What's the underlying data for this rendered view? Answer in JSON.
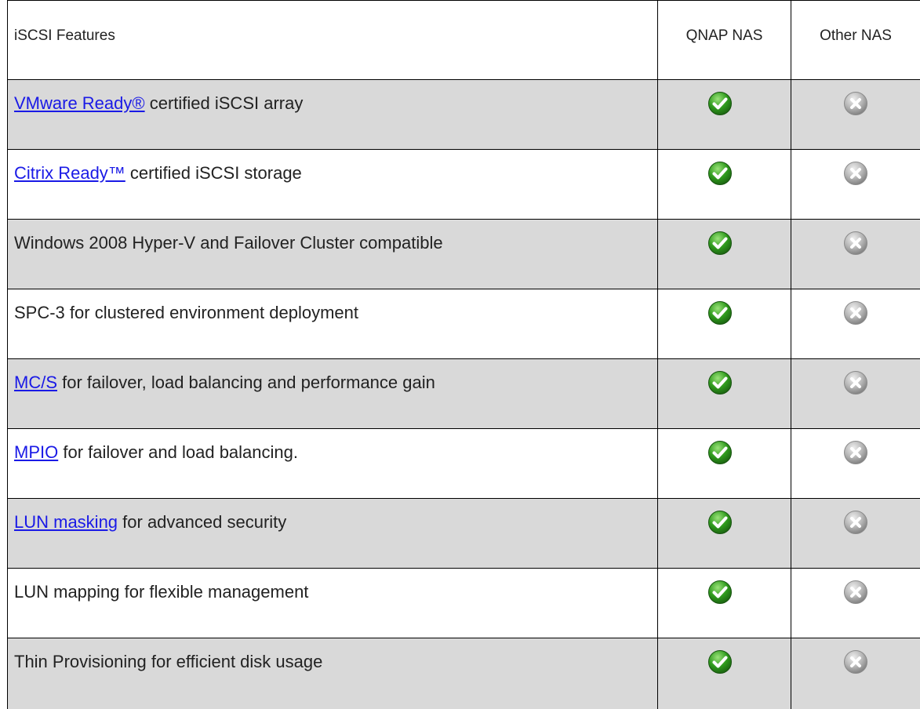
{
  "header": {
    "feature_label": "iSCSI Features",
    "qnap_label": "QNAP NAS",
    "other_label": "Other NAS"
  },
  "colors": {
    "shaded_row": "#d9d9d9",
    "link": "#1a1ae6",
    "check_green": "#2e9a1c",
    "cross_gray": "#b5b5b5"
  },
  "rows": [
    {
      "link": "VMware Ready®",
      "text": " certified iSCSI array",
      "qnap": "check-icon",
      "other": "cross-icon"
    },
    {
      "link": "Citrix Ready™",
      "text": " certified iSCSI storage",
      "qnap": "check-icon",
      "other": "cross-icon"
    },
    {
      "link": "",
      "text": "Windows 2008 Hyper-V and Failover Cluster compatible",
      "qnap": "check-icon",
      "other": "cross-icon"
    },
    {
      "link": "",
      "text": "SPC-3 for clustered environment deployment",
      "qnap": "check-icon",
      "other": "cross-icon"
    },
    {
      "link": "MC/S",
      "text": " for failover, load balancing and performance gain",
      "qnap": "check-icon",
      "other": "cross-icon"
    },
    {
      "link": "MPIO",
      "text": " for failover and load balancing.",
      "qnap": "check-icon",
      "other": "cross-icon"
    },
    {
      "link": "LUN masking",
      "text": " for advanced security",
      "qnap": "check-icon",
      "other": "cross-icon"
    },
    {
      "link": "",
      "text": "LUN mapping for flexible management",
      "qnap": "check-icon",
      "other": "cross-icon"
    },
    {
      "link": "",
      "text": "Thin Provisioning for efficient disk usage",
      "qnap": "check-icon",
      "other": "cross-icon"
    }
  ]
}
